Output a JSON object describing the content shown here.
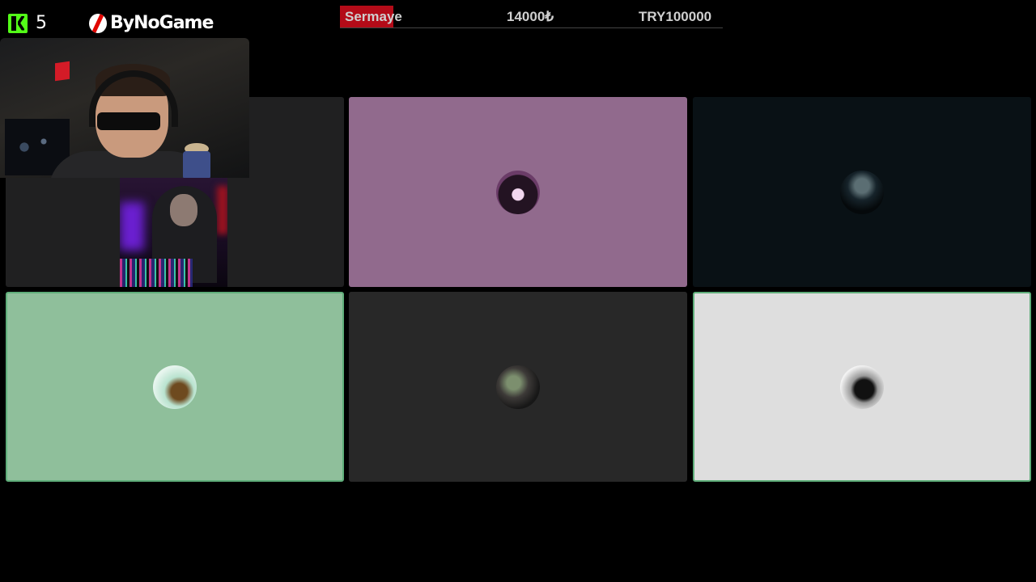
{
  "header": {
    "viewer_count": "5",
    "brand_name": "ByNoGame"
  },
  "progress_bar": {
    "label": "Sermaye",
    "current_amount": "14000₺",
    "goal_amount": "TRY100000",
    "fill_percent": 14,
    "fill_color": "#b30b18"
  },
  "tiles": [
    {
      "id": "tile-1",
      "background": "#202021"
    },
    {
      "id": "tile-2",
      "background": "#916a8d",
      "avatar_icon": "participant-avatar"
    },
    {
      "id": "tile-3",
      "background": "#091115",
      "avatar_icon": "participant-avatar"
    },
    {
      "id": "tile-4",
      "background": "#8fbf9b",
      "avatar_icon": "participant-avatar",
      "active_speaker": true
    },
    {
      "id": "tile-5",
      "background": "#282828",
      "avatar_icon": "participant-avatar"
    },
    {
      "id": "tile-6",
      "background": "#dedede",
      "avatar_icon": "participant-avatar",
      "active_speaker": true
    }
  ],
  "icons": {
    "viewers": "kick-logo-icon",
    "brand": "bynogame-logo-icon"
  }
}
